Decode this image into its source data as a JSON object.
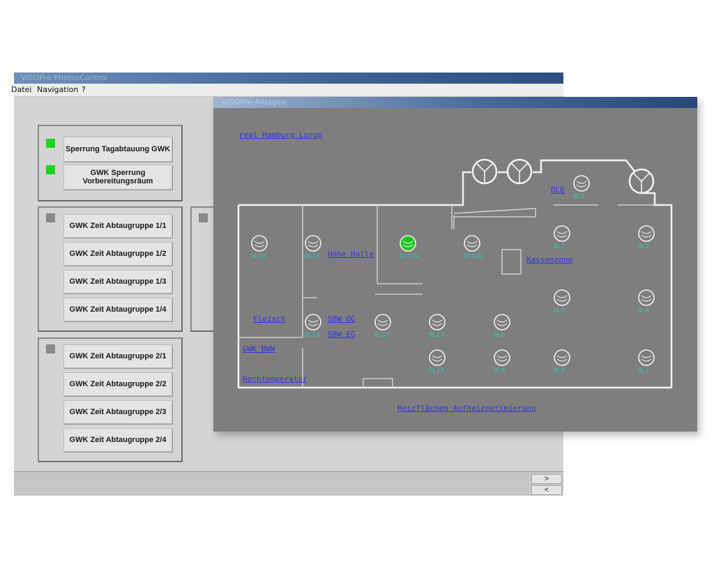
{
  "back_window": {
    "title": "VISOPro PhotosControl",
    "menu": [
      "Datei",
      "Navigation",
      "?"
    ],
    "group1": {
      "buttons": [
        "Sperrung Tagabtauung GWK",
        "GWK Sperrung\nVorbereitungsräum"
      ],
      "indicator_colors": [
        "#1ed41e",
        "#1ed41e"
      ]
    },
    "group2": {
      "indicator_color": "#8a8a8a",
      "buttons": [
        "GWK Zeit Abtaugruppe 1/1",
        "GWK Zeit Abtaugruppe 1/2",
        "GWK Zeit Abtaugruppe 1/3",
        "GWK Zeit Abtaugruppe 1/4"
      ]
    },
    "group3": {
      "indicator_color": "#8a8a8a",
      "buttons": [
        "GWK Zeit Abtaugruppe 2/1",
        "GWK Zeit Abtaugruppe 2/2",
        "GWK Zeit Abtaugruppe 2/3",
        "GWK Zeit Abtaugruppe 2/4"
      ]
    },
    "scroll_buttons": [
      ">",
      "<"
    ]
  },
  "front_window": {
    "title": "VISOPro Anlagen",
    "links": {
      "store": "real Hamburg Lurup",
      "hoehe_halle": "Höhe Halle",
      "kassenzone": "Kassenzone",
      "dle": "DLE",
      "fleisch": "Fleisch",
      "sbw_og": "SBW OG",
      "sbw_eg": "SBW EG",
      "gwk_bww": "GWK BWW",
      "hochtemperatur": "Hochtemperatur",
      "heizflaechen": "Heizflächen Aufheizoptimierung"
    },
    "units": [
      {
        "id": "DL16",
        "status": "off"
      },
      {
        "id": "DL15",
        "status": "off"
      },
      {
        "id": "DL17a",
        "status": "on"
      },
      {
        "id": "DL13b",
        "status": "off"
      },
      {
        "id": "DL1",
        "status": "off"
      },
      {
        "id": "DL2",
        "status": "off"
      },
      {
        "id": "DL3",
        "status": "off"
      },
      {
        "id": "DL5",
        "status": "off"
      },
      {
        "id": "DL4",
        "status": "off"
      },
      {
        "id": "DL14",
        "status": "off"
      },
      {
        "id": "DL17",
        "status": "off"
      },
      {
        "id": "DL12",
        "status": "off"
      },
      {
        "id": "DL6",
        "status": "off"
      },
      {
        "id": "DL13",
        "status": "off"
      },
      {
        "id": "DL9",
        "status": "off"
      },
      {
        "id": "DL8",
        "status": "off"
      },
      {
        "id": "DL7",
        "status": "off"
      }
    ],
    "colors": {
      "background": "#7e7e7e",
      "walls": "#f2f2f2",
      "link": "#3434e0",
      "unit_label": "#2ec8b8",
      "unit_on": "#22c422"
    }
  }
}
